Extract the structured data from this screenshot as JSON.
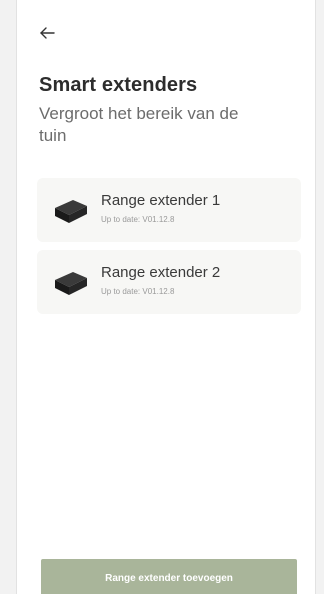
{
  "header": {
    "back_icon": "arrow-left-icon",
    "title": "Smart extenders",
    "subtitle": "Vergroot het bereik van de tuin"
  },
  "devices": [
    {
      "name": "Range extender 1",
      "status": "Up to date: V01.12.8",
      "icon": "range-extender-device-icon"
    },
    {
      "name": "Range extender 2",
      "status": "Up to date: V01.12.8",
      "icon": "range-extender-device-icon"
    }
  ],
  "footer": {
    "add_button_label": "Range extender toevoegen"
  },
  "colors": {
    "accent_button": "#a9b59a",
    "card_background": "#f7f7f5",
    "title_text": "#2d2d2d",
    "subtitle_text": "#6c6c6c"
  }
}
